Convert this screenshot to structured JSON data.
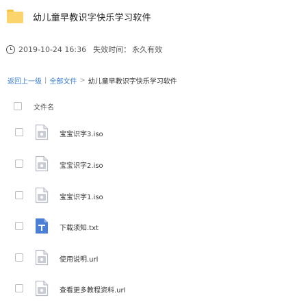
{
  "folder": {
    "name": "幼儿童早教识字快乐学习软件",
    "icon": "folder-icon"
  },
  "meta": {
    "date": "2019-10-24 16:36",
    "expire_label": "失效时间：",
    "expire_value": "永久有效"
  },
  "breadcrumb": {
    "back": "返回上一级",
    "all_files": "全部文件",
    "separator": ">",
    "current": "幼儿童早教识字快乐学习软件"
  },
  "list_header": {
    "name_column": "文件名"
  },
  "files": [
    {
      "name": "宝宝识字3.iso",
      "icon": "disc-file-icon"
    },
    {
      "name": "宝宝识字2.iso",
      "icon": "disc-file-icon"
    },
    {
      "name": "宝宝识字1.iso",
      "icon": "disc-file-icon"
    },
    {
      "name": "下载须知.txt",
      "icon": "text-file-icon"
    },
    {
      "name": "使用说明.url",
      "icon": "link-file-icon"
    },
    {
      "name": "查看更多教程资料.url",
      "icon": "link-file-icon"
    }
  ],
  "colors": {
    "accent_link": "#3a7dd1",
    "folder_yellow": "#fbd56c",
    "generic_file_gray": "#c9ccd3",
    "text_file_blue": "#4a7fd4"
  }
}
